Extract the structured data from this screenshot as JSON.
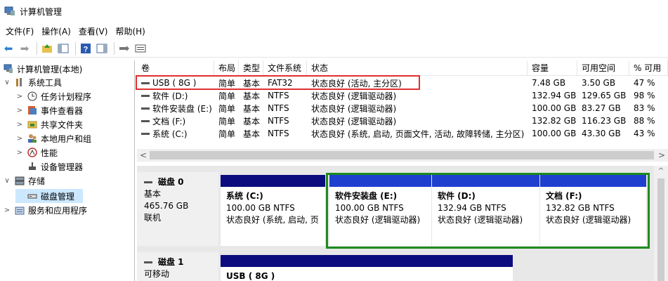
{
  "window": {
    "title": "计算机管理"
  },
  "menu": [
    "文件(F)",
    "操作(A)",
    "查看(V)",
    "帮助(H)"
  ],
  "tree": [
    {
      "label": "计算机管理(本地)",
      "level": 0,
      "expander": "",
      "icon": "computer-icon"
    },
    {
      "label": "系统工具",
      "level": 1,
      "expander": "v",
      "icon": "tools-icon"
    },
    {
      "label": "任务计划程序",
      "level": 2,
      "expander": ">",
      "icon": "clock-icon"
    },
    {
      "label": "事件查看器",
      "level": 2,
      "expander": ">",
      "icon": "event-viewer-icon"
    },
    {
      "label": "共享文件夹",
      "level": 2,
      "expander": ">",
      "icon": "shared-folder-icon"
    },
    {
      "label": "本地用户和组",
      "level": 2,
      "expander": ">",
      "icon": "users-icon"
    },
    {
      "label": "性能",
      "level": 2,
      "expander": ">",
      "icon": "performance-icon"
    },
    {
      "label": "设备管理器",
      "level": 2,
      "expander": "",
      "icon": "device-manager-icon"
    },
    {
      "label": "存储",
      "level": 1,
      "expander": "v",
      "icon": "storage-icon"
    },
    {
      "label": "磁盘管理",
      "level": 2,
      "expander": "",
      "icon": "disk-management-icon",
      "selected": true
    },
    {
      "label": "服务和应用程序",
      "level": 1,
      "expander": ">",
      "icon": "services-icon"
    }
  ],
  "columns": [
    "卷",
    "布局",
    "类型",
    "文件系统",
    "状态",
    "容量",
    "可用空间",
    "% 可用"
  ],
  "volumes": [
    [
      "USB ( 8G )",
      "简单",
      "基本",
      "FAT32",
      "状态良好 (活动, 主分区)",
      "7.48 GB",
      "3.50 GB",
      "47 %"
    ],
    [
      "软件 (D:)",
      "简单",
      "基本",
      "NTFS",
      "状态良好 (逻辑驱动器)",
      "132.94 GB",
      "129.65 GB",
      "98 %"
    ],
    [
      "软件安装盘 (E:)",
      "简单",
      "基本",
      "NTFS",
      "状态良好 (逻辑驱动器)",
      "100.00 GB",
      "83.27 GB",
      "83 %"
    ],
    [
      "文档 (F:)",
      "简单",
      "基本",
      "NTFS",
      "状态良好 (逻辑驱动器)",
      "132.82 GB",
      "116.23 GB",
      "88 %"
    ],
    [
      "系统 (C:)",
      "简单",
      "基本",
      "NTFS",
      "状态良好 (系统, 启动, 页面文件, 活动, 故障转储, 主分区)",
      "100.00 GB",
      "43.30 GB",
      "43 %"
    ]
  ],
  "disks": [
    {
      "name": "磁盘 0",
      "type": "基本",
      "size": "465.76 GB",
      "status": "联机",
      "partitions": [
        {
          "name": "系统  (C:)",
          "size": "100.00 GB NTFS",
          "status": "状态良好 (系统, 启动, 页"
        },
        {
          "name": "软件安装盘  (E:)",
          "size": "100.00 GB NTFS",
          "status": "状态良好 (逻辑驱动器)"
        },
        {
          "name": "软件  (D:)",
          "size": "132.94 GB NTFS",
          "status": "状态良好 (逻辑驱动器)"
        },
        {
          "name": "文档  (F:)",
          "size": "132.82 GB NTFS",
          "status": "状态良好 (逻辑驱动器)"
        }
      ]
    },
    {
      "name": "磁盘 1",
      "type": "可移动",
      "size": "",
      "status": "",
      "partitions": [
        {
          "name": "USB ( 8G )",
          "size": "",
          "status": ""
        }
      ]
    }
  ],
  "colors": {
    "primary_partition": "#0c0c7e",
    "logical_drive": "#1f3fcf",
    "extended_partition": "#1e8a1e",
    "selection": "#cce8ff",
    "annotation": "#e03030"
  }
}
